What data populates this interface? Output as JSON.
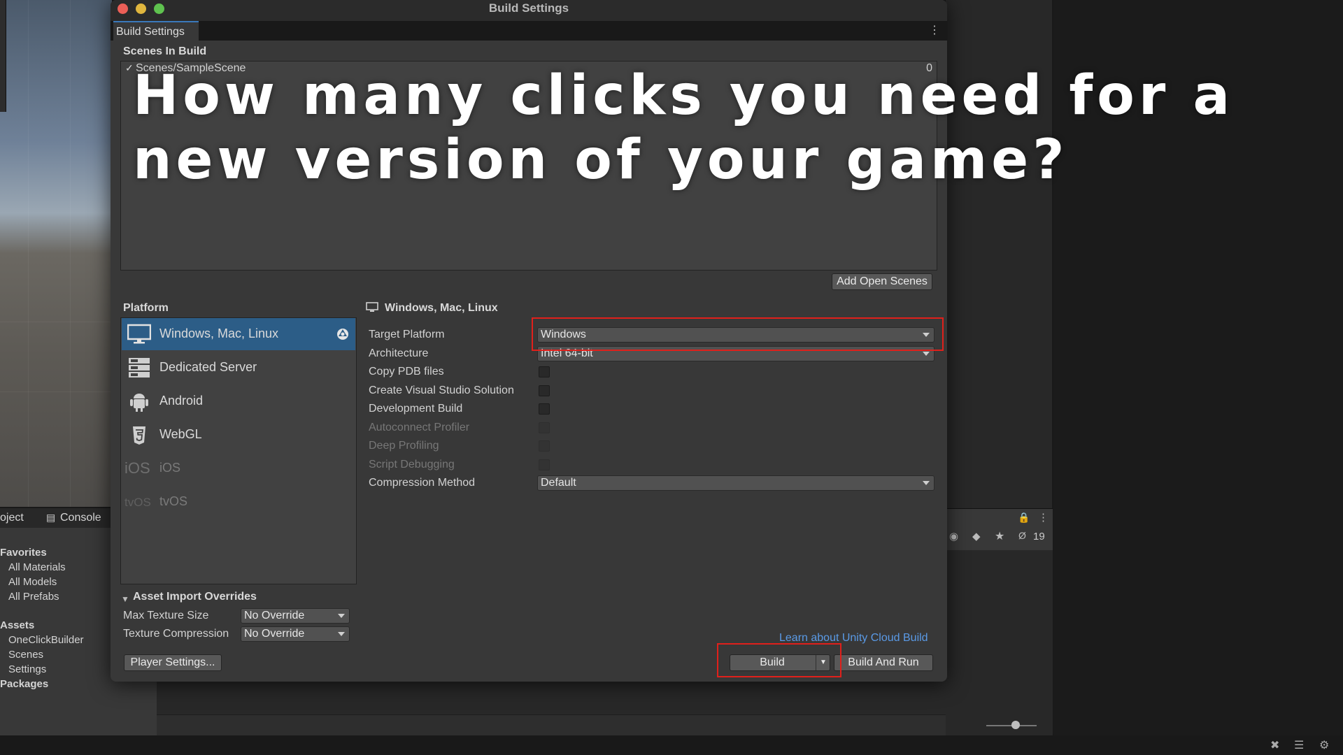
{
  "window": {
    "title": "Build Settings",
    "tab_label": "Build Settings"
  },
  "scenes": {
    "header": "Scenes In Build",
    "items": [
      {
        "name": "Scenes/SampleScene",
        "index": "0",
        "checked": true
      }
    ],
    "add_open_scenes_label": "Add Open Scenes"
  },
  "overlay": {
    "line1": "How many clicks you need for a",
    "line2": "new version of your game?"
  },
  "platform": {
    "header": "Platform",
    "items": [
      {
        "label": "Windows, Mac, Linux",
        "icon": "monitor-icon",
        "selected": true,
        "enabled": true
      },
      {
        "label": "Dedicated Server",
        "icon": "server-icon",
        "selected": false,
        "enabled": true
      },
      {
        "label": "Android",
        "icon": "android-icon",
        "selected": false,
        "enabled": true
      },
      {
        "label": "WebGL",
        "icon": "html5-icon",
        "selected": false,
        "enabled": true
      },
      {
        "label": "iOS",
        "icon_text": "iOS",
        "selected": false,
        "enabled": false
      },
      {
        "label": "tvOS",
        "icon_text": "tvOS",
        "selected": false,
        "enabled": false
      }
    ]
  },
  "settings": {
    "header": "Windows, Mac, Linux",
    "rows": [
      {
        "label": "Target Platform",
        "type": "dropdown",
        "value": "Windows",
        "enabled": true
      },
      {
        "label": "Architecture",
        "type": "dropdown",
        "value": "Intel 64-bit",
        "enabled": true
      },
      {
        "label": "Copy PDB files",
        "type": "checkbox",
        "checked": false,
        "enabled": true
      },
      {
        "label": "Create Visual Studio Solution",
        "type": "checkbox",
        "checked": false,
        "enabled": true
      },
      {
        "label": "Development Build",
        "type": "checkbox",
        "checked": false,
        "enabled": true
      },
      {
        "label": "Autoconnect Profiler",
        "type": "checkbox",
        "checked": false,
        "enabled": false
      },
      {
        "label": "Deep Profiling",
        "type": "checkbox",
        "checked": false,
        "enabled": false
      },
      {
        "label": "Script Debugging",
        "type": "checkbox",
        "checked": false,
        "enabled": false
      },
      {
        "label": "Compression Method",
        "type": "dropdown",
        "value": "Default",
        "enabled": true
      }
    ]
  },
  "asset_import": {
    "header": "Asset Import Overrides",
    "rows": [
      {
        "label": "Max Texture Size",
        "value": "No Override"
      },
      {
        "label": "Texture Compression",
        "value": "No Override"
      }
    ]
  },
  "footer": {
    "cloud_link": "Learn about Unity Cloud Build",
    "player_settings_label": "Player Settings...",
    "build_label": "Build",
    "build_and_run_label": "Build And Run"
  },
  "editor_background": {
    "project_tabs": {
      "project": "oject",
      "console": "Console"
    },
    "favorites_header": "Favorites",
    "favorites": [
      "All Materials",
      "All Models",
      "All Prefabs"
    ],
    "assets_header": "Assets",
    "assets": [
      "OneClickBuilder",
      "Scenes",
      "Settings"
    ],
    "packages_header": "Packages",
    "hidden_count": "19"
  },
  "colors": {
    "highlight_red": "#e0201b",
    "selection_blue": "#2c5d87",
    "link_blue": "#5a9ae6"
  }
}
